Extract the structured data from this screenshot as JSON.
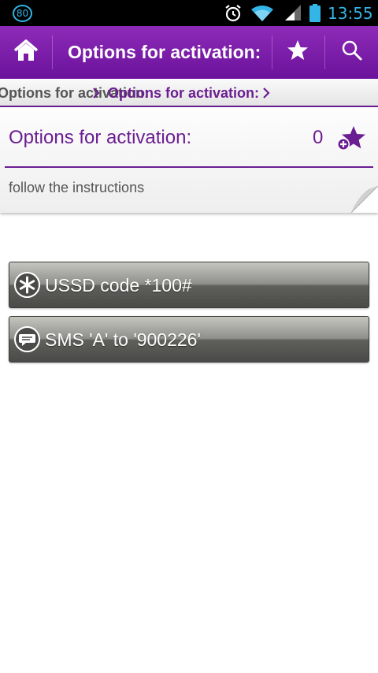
{
  "status_bar": {
    "badge": "80",
    "time": "13:55",
    "icons": [
      "alarm-icon",
      "wifi-icon",
      "signal-icon",
      "battery-icon"
    ]
  },
  "action_bar": {
    "title": "Options for activation:",
    "icons": [
      "home-icon",
      "star-icon",
      "search-icon"
    ]
  },
  "breadcrumb": {
    "items": [
      "Options for activation:",
      "Options for activation:"
    ]
  },
  "header": {
    "title": "Options for activation:",
    "count": "0",
    "subtitle": "follow the instructions"
  },
  "options": [
    {
      "label": "USSD code *100#",
      "icon": "asterisk-icon"
    },
    {
      "label": "SMS 'A' to '900226'",
      "icon": "message-icon"
    }
  ],
  "colors": {
    "accent": "#6b1e91",
    "actionbar": "#7b1fa2",
    "status_text": "#33b5e5"
  }
}
